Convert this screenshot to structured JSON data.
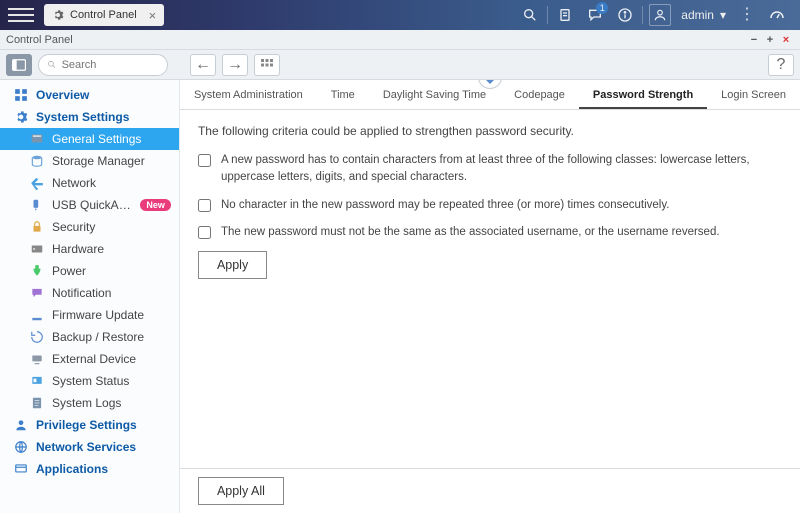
{
  "topbar": {
    "app_tab_label": "Control Panel",
    "user_label": "admin",
    "notification_count": "1"
  },
  "window": {
    "title": "Control Panel"
  },
  "toolbar": {
    "search_placeholder": "Search"
  },
  "sidebar": {
    "overview": "Overview",
    "system_settings": "System Settings",
    "system_settings_children": [
      {
        "label": "General Settings"
      },
      {
        "label": "Storage Manager"
      },
      {
        "label": "Network"
      },
      {
        "label": "USB QuickAccess",
        "badge": "New"
      },
      {
        "label": "Security"
      },
      {
        "label": "Hardware"
      },
      {
        "label": "Power"
      },
      {
        "label": "Notification"
      },
      {
        "label": "Firmware Update"
      },
      {
        "label": "Backup / Restore"
      },
      {
        "label": "External Device"
      },
      {
        "label": "System Status"
      },
      {
        "label": "System Logs"
      }
    ],
    "privilege": "Privilege Settings",
    "network_services": "Network Services",
    "applications": "Applications"
  },
  "tabs": {
    "items": [
      "System Administration",
      "Time",
      "Daylight Saving Time",
      "Codepage",
      "Password Strength",
      "Login Screen"
    ],
    "active_index": 4
  },
  "page": {
    "intro": "The following criteria could be applied to strengthen password security.",
    "criteria": [
      "A new password has to contain characters from at least three of the following classes: lowercase letters, uppercase letters, digits, and special characters.",
      "No character in the new password may be repeated three (or more) times consecutively.",
      "The new password must not be the same as the associated username, or the username reversed."
    ],
    "apply_label": "Apply",
    "apply_all_label": "Apply All"
  }
}
